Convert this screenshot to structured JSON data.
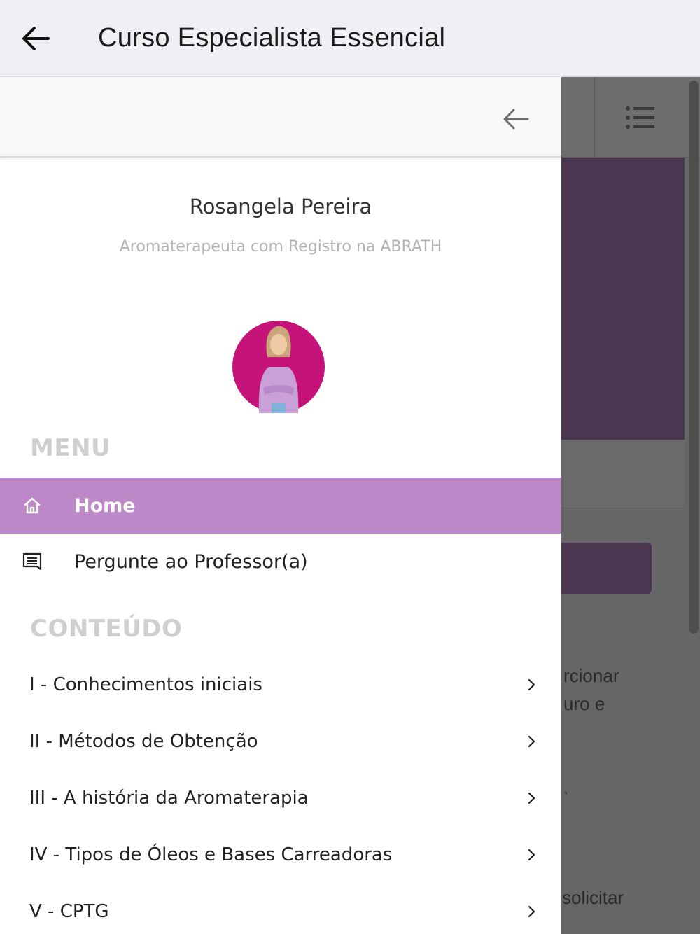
{
  "app_bar": {
    "title": "Curso Especialista Essencial"
  },
  "background": {
    "text_1": "rcionar",
    "text_2": "uro e",
    "text_3": ".",
    "text_4": "solicitar"
  },
  "profile": {
    "name": "Rosangela Pereira",
    "role": "Aromaterapeuta com Registro na ABRATH"
  },
  "menu": {
    "heading": "MENU",
    "items": [
      {
        "label": "Home",
        "icon": "home-icon",
        "active": true
      },
      {
        "label": "Pergunte ao Professor(a)",
        "icon": "message-icon",
        "active": false
      }
    ]
  },
  "content": {
    "heading": "CONTEÚDO",
    "items": [
      {
        "label": "I - Conhecimentos iniciais"
      },
      {
        "label": "II - Métodos de Obtenção"
      },
      {
        "label": "III - A história da Aromaterapia"
      },
      {
        "label": "IV - Tipos de Óleos e Bases Carreadoras"
      },
      {
        "label": "V - CPTG"
      }
    ]
  },
  "colors": {
    "accent": "#bd88c8",
    "banner": "#4a3650",
    "avatar_bg": "#c6137a"
  }
}
